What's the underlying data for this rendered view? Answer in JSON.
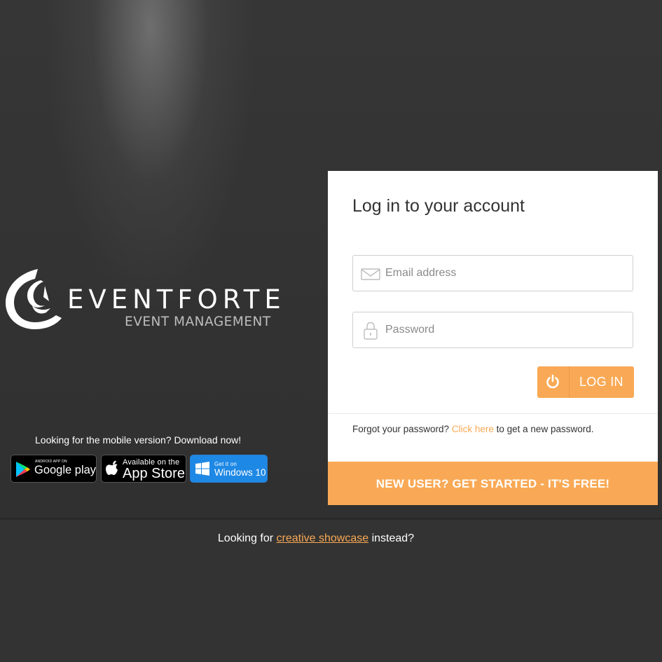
{
  "brand": {
    "name": "EVENTFORTE",
    "tagline": "EVENT MANAGEMENT"
  },
  "mobile": {
    "prompt": "Looking for the mobile version? Download now!",
    "stores": {
      "google": {
        "small": "ANDROID APP ON",
        "big": "Google play",
        "icon": "google-play-icon"
      },
      "apple": {
        "small": "Available on the",
        "big": "App Store",
        "icon": "apple-icon"
      },
      "windows": {
        "small": "Get it on",
        "big": "Windows 10",
        "icon": "windows-icon"
      }
    }
  },
  "login": {
    "title": "Log in to your account",
    "email_placeholder": "Email address",
    "email_value": "",
    "password_placeholder": "Password",
    "password_value": "",
    "button_label": "LOG IN",
    "forgot_prefix": "Forgot your password?",
    "forgot_link": "Click here",
    "forgot_suffix": "to get a new password.",
    "signup_cta": "NEW USER? GET STARTED - IT'S FREE!"
  },
  "footer": {
    "prefix": "Looking for",
    "link": "creative showcase",
    "suffix": "instead?"
  },
  "colors": {
    "accent": "#f9a955",
    "background": "#333333",
    "card": "#ffffff",
    "windows_blue": "#1e88e5"
  }
}
